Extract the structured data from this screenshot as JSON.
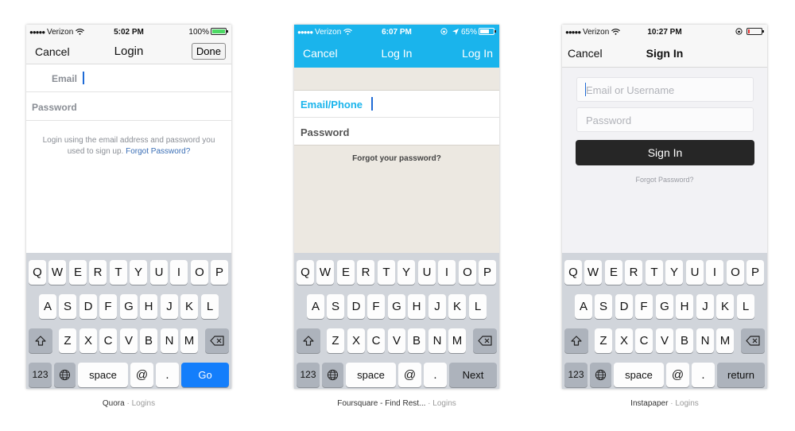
{
  "screens": [
    {
      "app_name": "Quora",
      "category": "Logins",
      "status": {
        "carrier": "Verizon",
        "time": "5:02 PM",
        "battery": "100%",
        "battery_level": 1.0
      },
      "nav": {
        "cancel": "Cancel",
        "title": "Login",
        "action": "Done"
      },
      "fields": {
        "email_label": "Email",
        "password_label": "Password"
      },
      "help": {
        "text": "Login using the email address and password you used to sign up.",
        "link": "Forgot Password?"
      },
      "return_key": "Go"
    },
    {
      "app_name": "Foursquare - Find Rest...",
      "category": "Logins",
      "status": {
        "carrier": "Verizon",
        "time": "6:07 PM",
        "battery": "65%",
        "battery_level": 0.65
      },
      "nav": {
        "cancel": "Cancel",
        "title": "Log In",
        "action": "Log In"
      },
      "fields": {
        "email_label": "Email/Phone",
        "password_label": "Password"
      },
      "forgot": "Forgot your password?",
      "return_key": "Next"
    },
    {
      "app_name": "Instapaper",
      "category": "Logins",
      "status": {
        "carrier": "Verizon",
        "time": "10:27 PM"
      },
      "nav": {
        "cancel": "Cancel",
        "title": "Sign In"
      },
      "fields": {
        "email_placeholder": "Email or Username",
        "password_placeholder": "Password"
      },
      "sign_in_button": "Sign In",
      "forgot": "Forgot Password?",
      "return_key": "return"
    }
  ],
  "keyboard": {
    "row1": [
      "Q",
      "W",
      "E",
      "R",
      "T",
      "Y",
      "U",
      "I",
      "O",
      "P"
    ],
    "row2": [
      "A",
      "S",
      "D",
      "F",
      "G",
      "H",
      "J",
      "K",
      "L"
    ],
    "row3": [
      "Z",
      "X",
      "C",
      "V",
      "B",
      "N",
      "M"
    ],
    "numbers": "123",
    "space": "space",
    "at": "@",
    "dot": "."
  },
  "colors": {
    "foursquare_blue": "#1ab4ec",
    "quora_link": "#3b6fb6",
    "go_key": "#147efb",
    "instapaper_button": "#262626"
  },
  "icons": [
    "wifi-icon",
    "battery-icon",
    "shift-icon",
    "backspace-icon",
    "globe-icon",
    "location-arrow-icon",
    "rotation-lock-icon"
  ]
}
